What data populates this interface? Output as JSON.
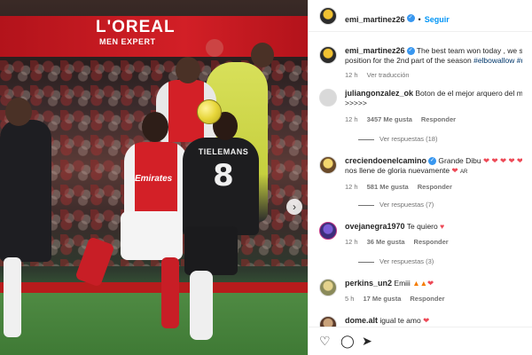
{
  "photo": {
    "banner_text": "L'OREAL",
    "banner_sub": "MEN EXPERT",
    "sponsor": "Emirates",
    "shirt_name": "TIELEMANS",
    "shirt_number": "8",
    "next_icon": "chevron-right-icon"
  },
  "header": {
    "username": "emi_martinez26",
    "follow_label": "Seguir"
  },
  "caption": {
    "username": "emi_martinez26",
    "text": "The best team won today , we still",
    "text2": "position for the 2nd part of the season",
    "hashtag": "#elbowallow #u",
    "time": "12 h",
    "translate": "Ver traducción"
  },
  "comments": [
    {
      "username": "juliangonzalez_ok",
      "text": "Boton de el mejor arquero del mund",
      "text2": ">>>>>",
      "time": "12 h",
      "likes": "3457 Me gusta",
      "reply": "Responder",
      "replies": "Ver respuestas (18)"
    },
    {
      "username": "creciendoenelcamino",
      "text": "Grande Dibu",
      "text_tail": "que",
      "text2": "nos llene de gloria nuevamente",
      "text2_tail": "AR",
      "time": "12 h",
      "likes": "581 Me gusta",
      "reply": "Responder",
      "replies": "Ver respuestas (7)"
    },
    {
      "username": "ovejanegra1970",
      "text": "Te quiero",
      "time": "12 h",
      "likes": "36 Me gusta",
      "reply": "Responder",
      "replies": "Ver respuestas (3)"
    },
    {
      "username": "perkins_un2",
      "text": "Emiii",
      "time": "5 h",
      "likes": "17 Me gusta",
      "reply": "Responder"
    },
    {
      "username": "dome.alt",
      "text": "igual te amo"
    }
  ],
  "actions": {
    "like_icon": "heart-icon",
    "comment_icon": "comment-icon",
    "share_icon": "share-icon"
  },
  "colors": {
    "follow": "#0095f6",
    "verified": "#3897f0",
    "hashtag": "#00376b",
    "red": "#ed4956"
  }
}
